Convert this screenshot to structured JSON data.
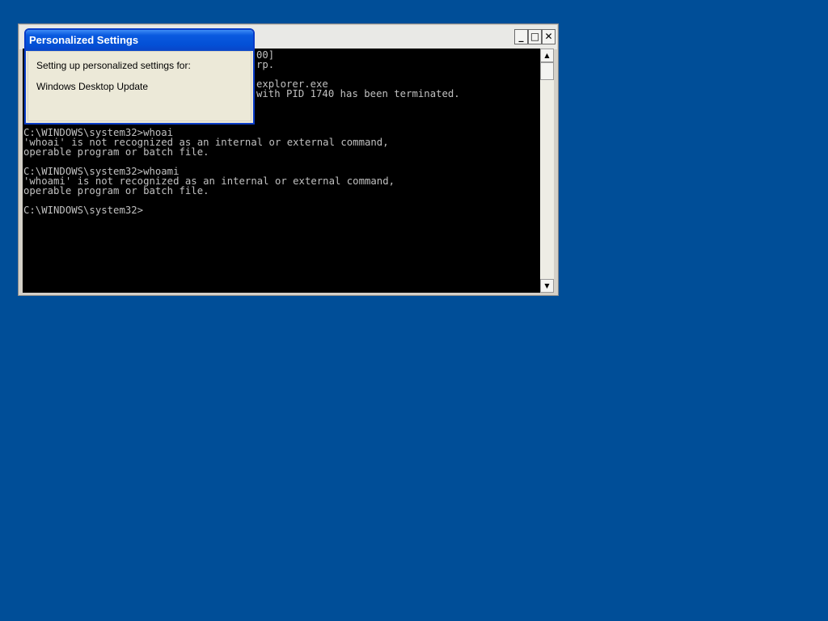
{
  "console": {
    "lines": [
      "",
      "",
      "",
      "",
      "",
      "",
      "",
      "",
      "C:\\WINDOWS\\system32>whoai",
      "'whoai' is not recognized as an internal or external command,",
      "operable program or batch file.",
      "",
      "C:\\WINDOWS\\system32>whoami",
      "'whoami' is not recognized as an internal or external command,",
      "operable program or batch file.",
      "",
      "C:\\WINDOWS\\system32>"
    ],
    "partial_line_1": "00]",
    "partial_line_2": "rp.",
    "partial_line_4": "explorer.exe",
    "partial_line_5": "with PID 1740 has been terminated.",
    "minimize_glyph": "_",
    "maximize_glyph": "□",
    "close_glyph": "✕",
    "scroll_up_glyph": "▲",
    "scroll_down_glyph": "▼"
  },
  "dialog": {
    "title": "Personalized Settings",
    "line1": "Setting up personalized settings for:",
    "line2": "Windows Desktop Update"
  },
  "colors": {
    "desktop": "#004e98",
    "console_bg": "#000000",
    "console_fg": "#c0c0c0",
    "title_blue": "#0a5ae0"
  }
}
